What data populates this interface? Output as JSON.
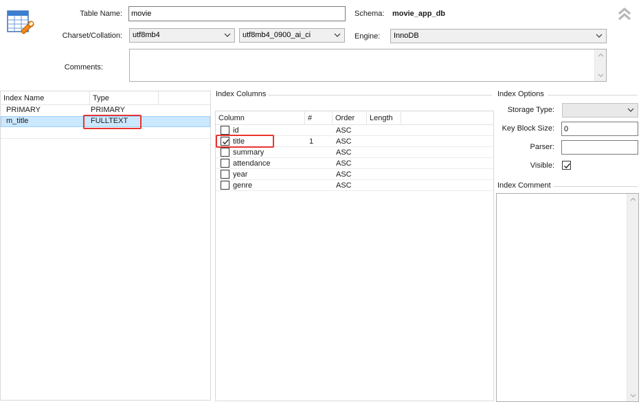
{
  "header": {
    "table_name_label": "Table Name:",
    "table_name_value": "movie",
    "schema_label": "Schema:",
    "schema_value": "movie_app_db",
    "charset_label": "Charset/Collation:",
    "charset_value": "utf8mb4",
    "collation_value": "utf8mb4_0900_ai_ci",
    "engine_label": "Engine:",
    "engine_value": "InnoDB",
    "comments_label": "Comments:",
    "comments_value": ""
  },
  "index_grid": {
    "columns": [
      "Index Name",
      "Type"
    ],
    "rows": [
      {
        "name": "PRIMARY",
        "type": "PRIMARY"
      },
      {
        "name": "m_title",
        "type": "FULLTEXT"
      }
    ],
    "selected_row": 1
  },
  "index_columns": {
    "title": "Index Columns",
    "headers": [
      "Column",
      "#",
      "Order",
      "Length"
    ],
    "rows": [
      {
        "column": "id",
        "checked": false,
        "num": "",
        "order": "ASC",
        "length": ""
      },
      {
        "column": "title",
        "checked": true,
        "num": "1",
        "order": "ASC",
        "length": ""
      },
      {
        "column": "summary",
        "checked": false,
        "num": "",
        "order": "ASC",
        "length": ""
      },
      {
        "column": "attendance",
        "checked": false,
        "num": "",
        "order": "ASC",
        "length": ""
      },
      {
        "column": "year",
        "checked": false,
        "num": "",
        "order": "ASC",
        "length": ""
      },
      {
        "column": "genre",
        "checked": false,
        "num": "",
        "order": "ASC",
        "length": ""
      }
    ]
  },
  "index_options": {
    "title": "Index Options",
    "storage_type_label": "Storage Type:",
    "storage_type_value": "",
    "key_block_size_label": "Key Block Size:",
    "key_block_size_value": "0",
    "parser_label": "Parser:",
    "parser_value": "",
    "visible_label": "Visible:",
    "visible_checked": true
  },
  "index_comment": {
    "title": "Index Comment",
    "value": ""
  },
  "colors": {
    "selection": "#cce8ff",
    "highlight_box": "#e8332e"
  },
  "icons": [
    "table-editor-icon",
    "collapse-up-icon",
    "chevron-down-icon",
    "checkmark-icon"
  ]
}
